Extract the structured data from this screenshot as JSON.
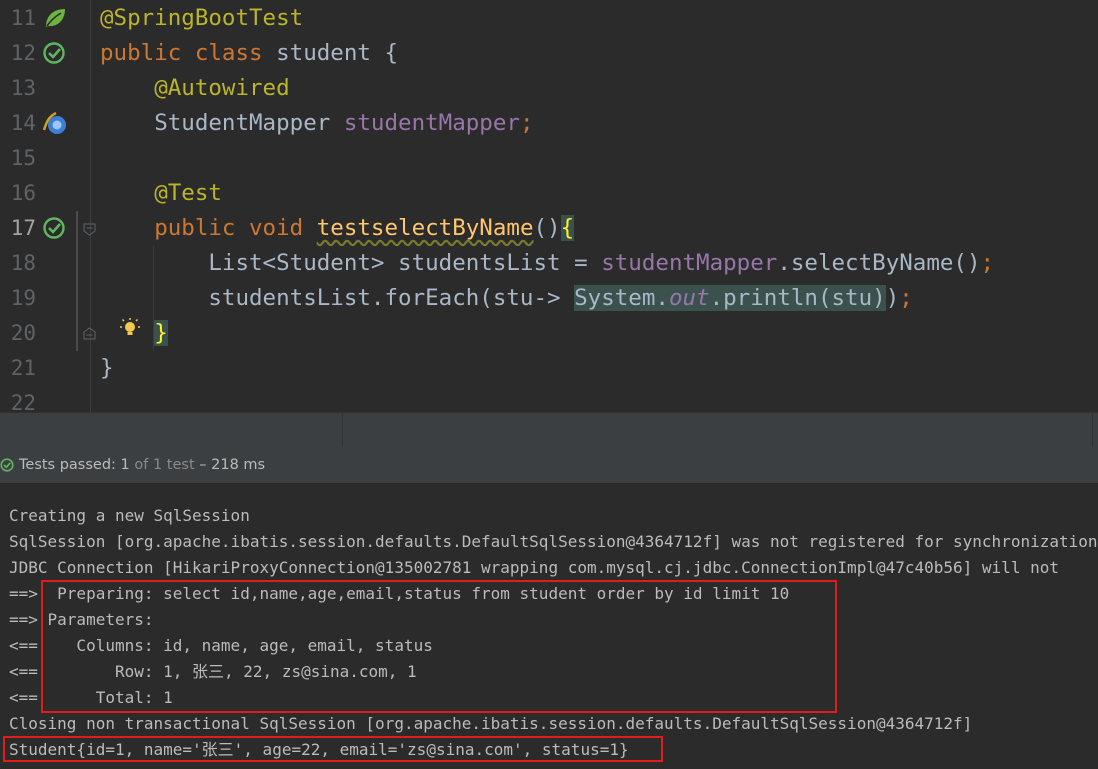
{
  "editor": {
    "line_numbers": [
      "11",
      "12",
      "13",
      "14",
      "15",
      "16",
      "17",
      "18",
      "19",
      "20",
      "21",
      "22"
    ],
    "lines": {
      "l11": {
        "ann": "@SpringBootTest"
      },
      "l12": {
        "kw1": "public",
        "kw2": "class",
        "name": "student",
        "brace": "{"
      },
      "l13": {
        "ann": "@Autowired"
      },
      "l14": {
        "type": "StudentMapper",
        "field": "studentMapper",
        "semi": ";"
      },
      "l16": {
        "ann": "@Test"
      },
      "l17": {
        "kw1": "public",
        "kw2": "void",
        "method": "testselectByName",
        "parens": "()",
        "brace": "{"
      },
      "l18": {
        "pre": "List<Student> studentsList = ",
        "field": "studentMapper",
        "post": ".selectByName()",
        "semi": ";"
      },
      "l19": {
        "pre": "studentsList.forEach(stu-> ",
        "sys": "System.",
        "out": "out",
        "post": ".println(stu)",
        "close": ")",
        "semi": ";"
      },
      "l20": {
        "brace": "}"
      },
      "l21": {
        "brace": "}"
      }
    },
    "gutter_icons": [
      "spring-leaf-icon",
      "test-passed-icon",
      "bean-autowired-icon",
      "test-passed-icon",
      "intention-bulb-icon"
    ]
  },
  "test_status": {
    "label": "Tests passed:",
    "count": "1",
    "of": "of 1 test",
    "duration": "– 218 ms"
  },
  "console": {
    "lines": [
      "Creating a new SqlSession",
      "SqlSession [org.apache.ibatis.session.defaults.DefaultSqlSession@4364712f] was not registered for synchronization",
      "JDBC Connection [HikariProxyConnection@135002781 wrapping com.mysql.cj.jdbc.ConnectionImpl@47c40b56] will not",
      "==>  Preparing: select id,name,age,email,status from student order by id limit 10",
      "==> Parameters: ",
      "<==    Columns: id, name, age, email, status",
      "<==        Row: 1, 张三, 22, zs@sina.com, 1",
      "<==      Total: 1",
      "Closing non transactional SqlSession [org.apache.ibatis.session.defaults.DefaultSqlSession@4364712f]",
      "Student{id=1, name='张三', age=22, email='zs@sina.com', status=1}"
    ]
  },
  "colors": {
    "editor_bg": "#2b2b2b",
    "keyword": "#cc7832",
    "annotation": "#bbb529",
    "field": "#9876aa",
    "method": "#ffc66d",
    "highlight_box": "#e01c1c",
    "passed_green": "#5fb65f"
  }
}
